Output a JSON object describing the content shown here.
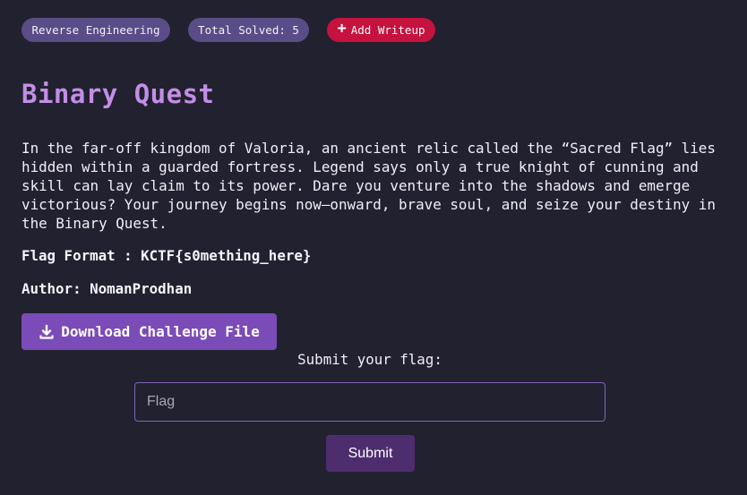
{
  "badges": {
    "category": "Reverse Engineering",
    "solved": "Total Solved: 5",
    "add_writeup": "Add Writeup"
  },
  "challenge": {
    "title": "Binary Quest",
    "description": "In the far-off kingdom of Valoria, an ancient relic called the “Sacred Flag” lies hidden within a guarded fortress. Legend says only a true knight of cunning and skill can lay claim to its power. Dare you venture into the shadows and emerge victorious? Your journey begins now—onward, brave soul, and seize your destiny in the Binary Quest.",
    "flag_format": "Flag Format : KCTF{s0mething_here}",
    "author": "Author: NomanProdhan"
  },
  "download": {
    "label": "Download Challenge File",
    "icon": "download-icon"
  },
  "submission": {
    "label": "Submit your flag:",
    "placeholder": "Flag",
    "value": "",
    "button": "Submit"
  },
  "colors": {
    "background": "#22212f",
    "title": "#c28ee6",
    "badge": "#5a4c86",
    "writeup": "#c5123f",
    "download": "#7b4bb8",
    "submit": "#4e2d6e",
    "input_border": "#7c66b8"
  }
}
